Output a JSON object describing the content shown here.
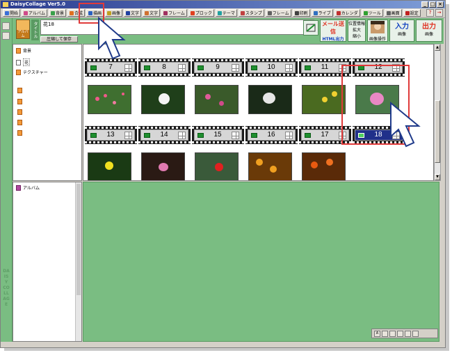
{
  "window": {
    "title": "DaisyCollage Ver5.0",
    "controls": [
      "_",
      "□",
      "×"
    ],
    "brand_vertical": "DAISY COLLAGE"
  },
  "toolbar": {
    "items": [
      {
        "label": "開始",
        "icon": "start-icon",
        "color": "#3a6fd8"
      },
      {
        "label": "アルバム",
        "icon": "album-icon",
        "color": "#d04a8a"
      },
      {
        "label": "背景",
        "icon": "background-icon",
        "color": "#3aa04a"
      },
      {
        "label": "合成",
        "icon": "composite-icon",
        "color": "#e07020"
      },
      {
        "label": "描画",
        "icon": "draw-icon",
        "color": "#2a60c0"
      },
      {
        "label": "画像",
        "icon": "image-icon",
        "color": "#c0a020"
      },
      {
        "label": "文字",
        "icon": "text-icon",
        "color": "#2040a0"
      },
      {
        "label": "文字",
        "icon": "text-art-icon",
        "color": "#d07030"
      },
      {
        "label": "フレーム",
        "icon": "frame-icon",
        "color": "#a03060"
      },
      {
        "label": "プロック",
        "icon": "block-icon",
        "color": "#e04020"
      },
      {
        "label": "テーマ",
        "icon": "theme-icon",
        "color": "#20a0a0"
      },
      {
        "label": "スタンプ",
        "icon": "stamp-icon",
        "color": "#c04040"
      },
      {
        "label": "フレーム",
        "icon": "frame2-icon",
        "color": "#606060"
      },
      {
        "label": "印刷",
        "icon": "print-icon",
        "color": "#404040"
      },
      {
        "label": "ライブ",
        "icon": "live-icon",
        "color": "#3070c0"
      },
      {
        "label": "カレンダ",
        "icon": "calendar-icon",
        "color": "#c03030"
      },
      {
        "label": "ツール",
        "icon": "tool-icon",
        "color": "#30a030"
      },
      {
        "label": "画面",
        "icon": "screen-icon",
        "color": "#606060"
      },
      {
        "label": "設定",
        "icon": "settings-icon",
        "color": "#c02020"
      }
    ]
  },
  "header": {
    "thumb_label": "アルバム",
    "title_label": "タイトル",
    "title_value": "花18",
    "save_label": "圧縮して保存",
    "mail_label": "メール送信",
    "html_label": "HTML出力",
    "position_label": "位置情報",
    "enlarge_label": "拡大",
    "shrink_label": "縮小",
    "image_op_label": "画像操作",
    "input_label": "入力",
    "output_label": "出力",
    "image_label": "画像"
  },
  "tree": {
    "items": [
      {
        "label": "背景"
      },
      {
        "label": "花"
      },
      {
        "label": "テクスチャー"
      }
    ]
  },
  "album": {
    "label": "アルバム"
  },
  "film": {
    "rows": [
      [
        {
          "num": "7"
        },
        {
          "num": "8"
        },
        {
          "num": "9"
        },
        {
          "num": "10"
        },
        {
          "num": "11"
        },
        {
          "num": "12"
        }
      ],
      [
        {
          "num": "13"
        },
        {
          "num": "14"
        },
        {
          "num": "15"
        },
        {
          "num": "16"
        },
        {
          "num": "17"
        },
        {
          "num": "18"
        }
      ]
    ],
    "selected": "18"
  },
  "colors": {
    "panel_green": "#7abd82",
    "highlight_red": "#e03a3a",
    "selection_navy": "#20308a"
  }
}
